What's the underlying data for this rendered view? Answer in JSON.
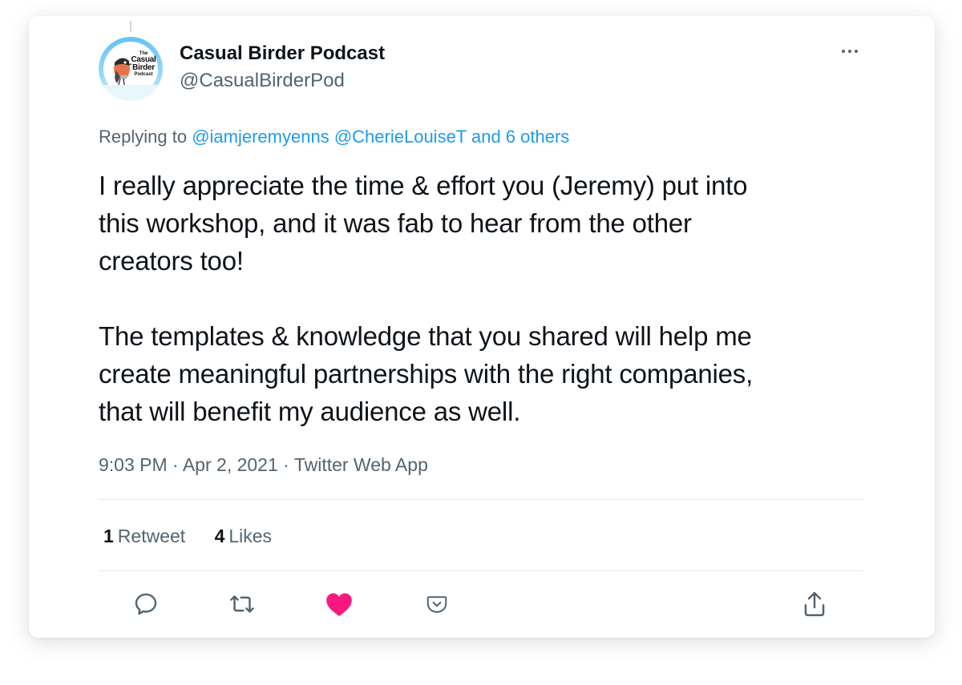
{
  "author": {
    "display_name": "Casual Birder Podcast",
    "handle": "@CasualBirderPod",
    "avatar": {
      "line1": "The",
      "line2": "Casual",
      "line3": "Birder",
      "line4": "Podcast"
    }
  },
  "reply_context": {
    "prefix": "Replying to",
    "mention_1": "@iamjeremyenns",
    "mention_2": "@CherieLouiseT",
    "others": "and 6 others"
  },
  "tweet": {
    "text": "I really appreciate the time & effort you (Jeremy) put into\nthis workshop, and it was fab to hear from the other\ncreators too!\n\nThe templates & knowledge that you shared will help me\ncreate meaningful partnerships with the right companies,\nthat will benefit my audience as well."
  },
  "meta": {
    "time": "9:03 PM",
    "separator": "·",
    "date": "Apr 2, 2021",
    "source": "Twitter Web App"
  },
  "stats": {
    "retweets_count": "1",
    "retweets_label": "Retweet",
    "likes_count": "4",
    "likes_label": "Likes"
  },
  "actions": {
    "reply_icon": "reply-icon",
    "retweet_icon": "retweet-icon",
    "like_icon": "heart-icon",
    "like_state": "liked",
    "pocket_icon": "pocket-icon",
    "share_icon": "share-icon"
  },
  "colors": {
    "link": "#1d9bf0",
    "secondary_text": "#536471",
    "primary_text": "#0f1419",
    "liked": "#f91880"
  }
}
